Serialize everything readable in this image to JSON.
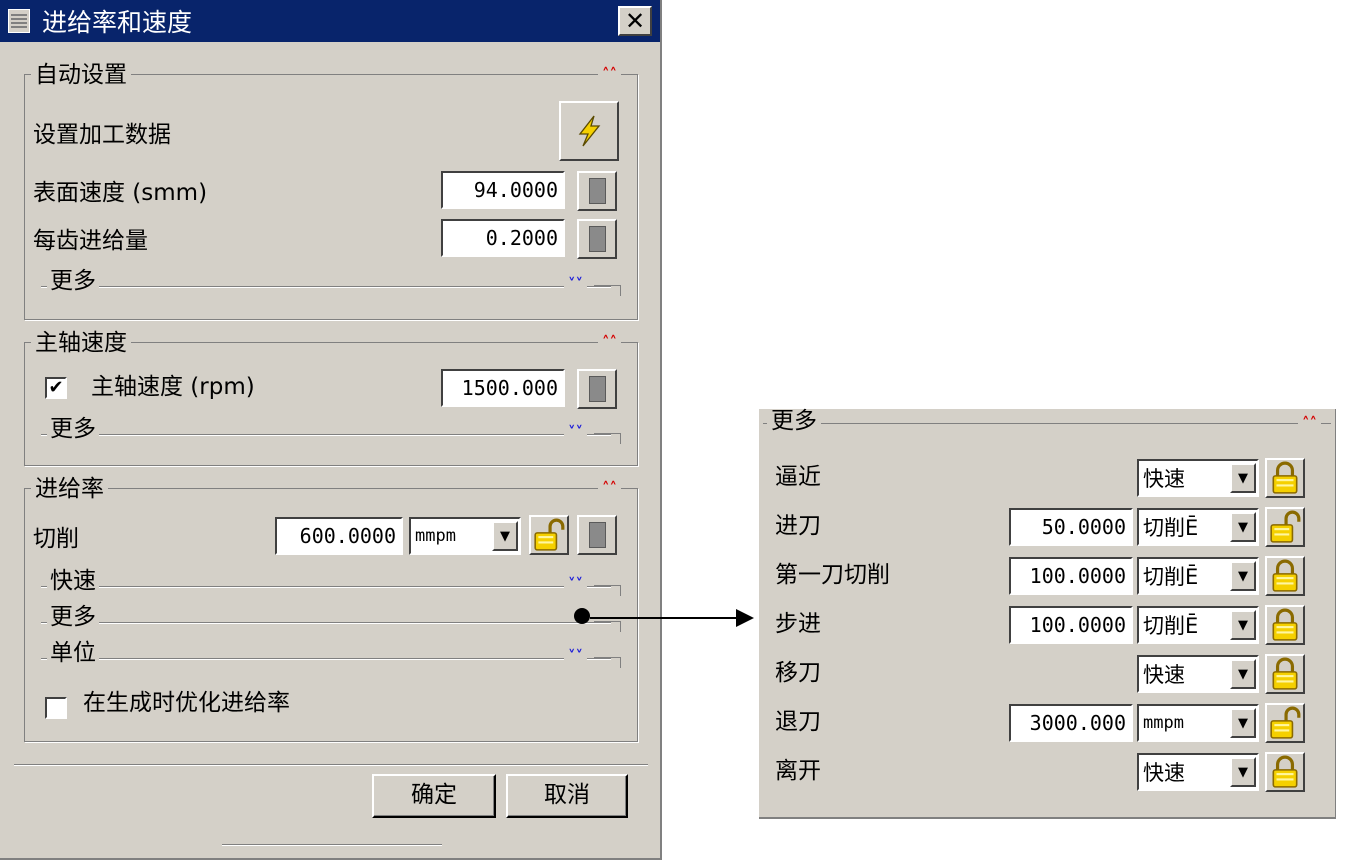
{
  "dialog": {
    "title": "进给率和速度",
    "close": "✕",
    "auto_settings": {
      "title": "自动设置",
      "set_data_label": "设置加工数据",
      "surface_speed_label": "表面速度 (smm)",
      "surface_speed_value": "94.0000",
      "feed_per_tooth_label": "每齿进给量",
      "feed_per_tooth_value": "0.2000",
      "more_label": "更多"
    },
    "spindle": {
      "title": "主轴速度",
      "checkbox_checked": "✔",
      "spindle_speed_label": "主轴速度 (rpm)",
      "spindle_speed_value": "1500.000",
      "more_label": "更多"
    },
    "feed": {
      "title": "进给率",
      "cut_label": "切削",
      "cut_value": "600.0000",
      "cut_unit": "mmpm",
      "rapid_label": "快速",
      "more_label": "更多",
      "units_label": "单位",
      "optimize_label": "在生成时优化进给率"
    },
    "ok_label": "确定",
    "cancel_label": "取消"
  },
  "more_panel": {
    "title": "更多",
    "rows": [
      {
        "label": "逼近",
        "value": "",
        "unit": "快速",
        "locked": true
      },
      {
        "label": "进刀",
        "value": "50.0000",
        "unit": "切削Ē",
        "locked": false
      },
      {
        "label": "第一刀切削",
        "value": "100.0000",
        "unit": "切削Ē",
        "locked": true
      },
      {
        "label": "步进",
        "value": "100.0000",
        "unit": "切削Ē",
        "locked": true
      },
      {
        "label": "移刀",
        "value": "",
        "unit": "快速",
        "locked": true
      },
      {
        "label": "退刀",
        "value": "3000.000",
        "unit": "mmpm",
        "locked": false
      },
      {
        "label": "离开",
        "value": "",
        "unit": "快速",
        "locked": true
      }
    ]
  },
  "colors": {
    "title_bar": "#08246b",
    "dialog_bg": "#d4d0c8",
    "expand_chevron": "#1c1cd8",
    "collapse_chevron": "#d40000",
    "lock_yellow": "#f5d000"
  }
}
